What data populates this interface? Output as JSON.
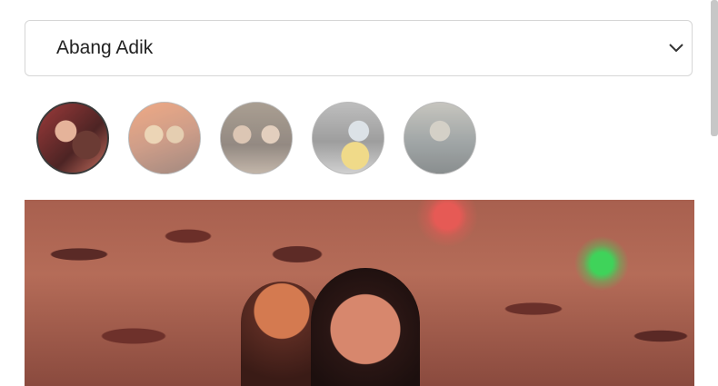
{
  "dropdown": {
    "selected": "Abang Adik",
    "icon": "chevron-down-icon"
  },
  "thumbnails": [
    {
      "label": "",
      "active": true
    },
    {
      "label": "",
      "active": false
    },
    {
      "label": "",
      "active": false
    },
    {
      "label": "",
      "active": false
    },
    {
      "label": "",
      "active": false
    }
  ],
  "hero": {
    "active_index": 0
  },
  "colors": {
    "border": "#d6d6d6",
    "text": "#222222",
    "active_ring": "#3a3a3a"
  }
}
